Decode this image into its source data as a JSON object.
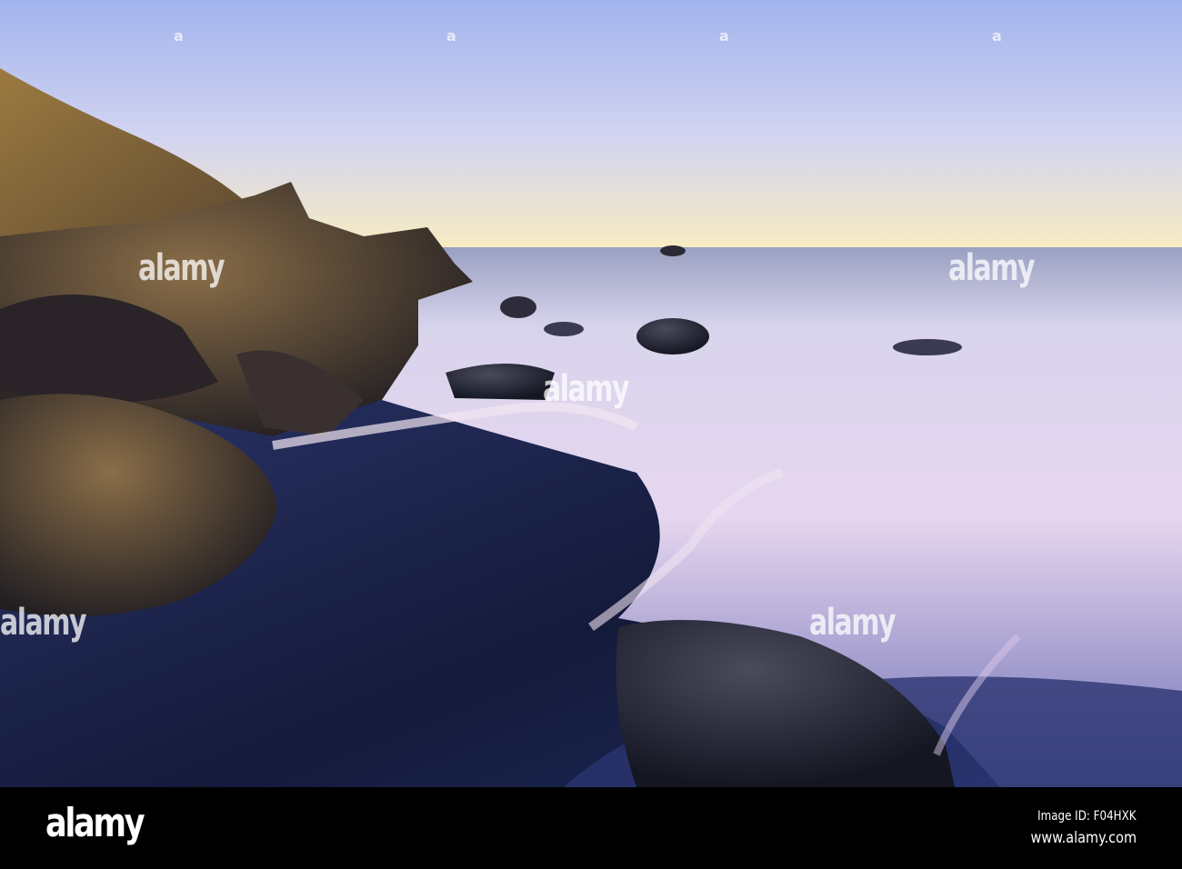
{
  "photo": {
    "subject": "Rocky coastline at sunset with long-exposure waves",
    "colors": {
      "sky_top": "#a9b8ee",
      "sky_horizon": "#f7ecc6",
      "sea": "#e3d8f0",
      "sand": "#1b2446",
      "rock": "#3a3430",
      "rock_lit": "#b08850"
    }
  },
  "watermark": {
    "text": "alamy",
    "mark": "a"
  },
  "footer": {
    "logo": "alamy",
    "image_id": "Image ID: F04HXK",
    "site": "www.alamy.com"
  }
}
